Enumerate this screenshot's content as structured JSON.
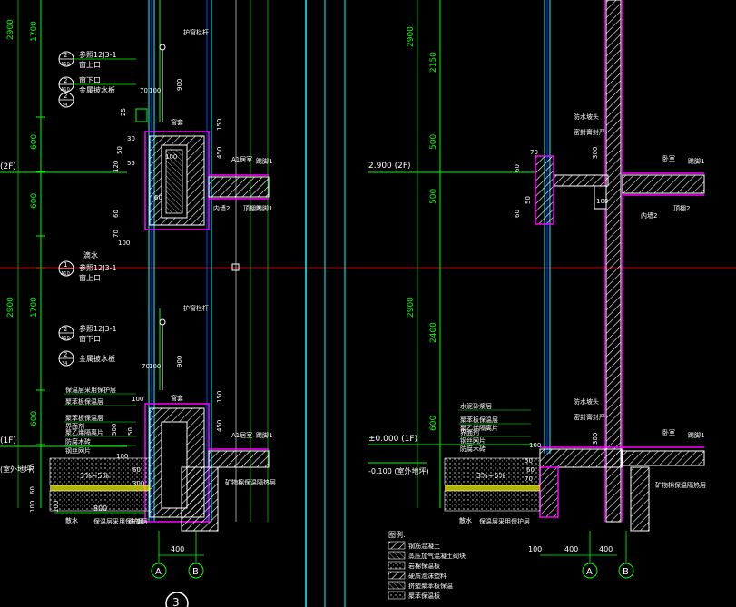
{
  "colors": {
    "background": "#000000",
    "dim_green": "#00ff00",
    "wall_white": "#ffffff",
    "hatch_magenta": "#ff00ff",
    "cyan": "#00ffff",
    "blue": "#0044ff",
    "axis_red": "#ff0000",
    "yellow": "#ffff00"
  },
  "left_detail": {
    "vertical_dims": [
      "2900",
      "1700",
      "600",
      "600",
      "2900",
      "1700",
      "600"
    ],
    "level_marks": [
      "(2F)",
      "(1F)",
      "(室外地坪)"
    ],
    "callouts": [
      {
        "num": "2",
        "sub": "A10",
        "text": "参照12J3-1"
      },
      {
        "num": "2",
        "sub": "A10",
        "text": "窗下口"
      },
      {
        "num": "2",
        "sub": "34",
        "text": "金属披水板"
      },
      {
        "num": "1",
        "sub": "A10",
        "text": "参照12J3-1"
      },
      {
        "num": "2",
        "sub": "A10",
        "text": "参照12J3-1"
      },
      {
        "num": "2",
        "sub": "34",
        "text": "金属披水板"
      }
    ],
    "extra_callout_texts": [
      "窗上口",
      "窗上口",
      "窗下口",
      "滴水"
    ],
    "labels": [
      "护窗栏杆",
      "护窗栏杆",
      "窗套",
      "窗套",
      "A1居室",
      "A1居室",
      "踢脚1",
      "踢脚1",
      "内墙2",
      "顶棚2",
      "散水",
      "防潮层",
      "踢脚1"
    ],
    "wall_notes": [
      "保温层采用保护层",
      "聚苯板保温层",
      "聚苯板保温层",
      "界面剂",
      "聚乙烯隔离片",
      "防腐木砖",
      "钢丝网片",
      "保温层采用保护层"
    ],
    "small_dims": [
      "25",
      "70",
      "100",
      "50",
      "30",
      "120",
      "55",
      "60",
      "70",
      "100",
      "900",
      "150",
      "450",
      "100",
      "60",
      "70",
      "100",
      "100",
      "900",
      "150",
      "450",
      "500",
      "50",
      "100",
      "30",
      "60",
      "60",
      "100",
      "300",
      "100"
    ],
    "slope": "3%~5%",
    "bottom_dims": [
      "800",
      "400"
    ],
    "section_note": "矿物棉保温隔热层",
    "axes": [
      "A",
      "B"
    ]
  },
  "right_detail": {
    "vertical_dims": [
      "2900",
      "2150",
      "500",
      "500",
      "2900",
      "2400",
      "600"
    ],
    "level_labels": [
      "2.900 (2F)",
      "±0.000 (1F)",
      "-0.100 (室外地坪)"
    ],
    "labels": [
      "防水坡头",
      "防水坡头",
      "密封膏封严",
      "密封膏封严",
      "卧室",
      "卧室",
      "踢脚1",
      "踢脚1",
      "内墙2",
      "顶棚2",
      "散水"
    ],
    "wall_notes": [
      "水泥砂浆层",
      "聚苯板保温层",
      "聚乙烯隔离片",
      "界面剂",
      "钢丝网片",
      "防腐木砖",
      "保温层采用保护层"
    ],
    "small_dims": [
      "60",
      "70",
      "50",
      "60",
      "100",
      "300",
      "300",
      "100",
      "50",
      "60",
      "70"
    ],
    "slope": "3%~5%",
    "bottom_dims": [
      "100",
      "400",
      "400"
    ],
    "section_note": "矿物棉保温隔热层",
    "axes": [
      "A",
      "B"
    ]
  },
  "legend": {
    "title": "图例:",
    "items": [
      "钢筋混凝土",
      "蒸压加气混凝土砌块",
      "岩棉保温板",
      "硬质泡沫塑料",
      "挤塑聚苯板保温",
      "聚苯保温板"
    ]
  },
  "view_number": "3"
}
